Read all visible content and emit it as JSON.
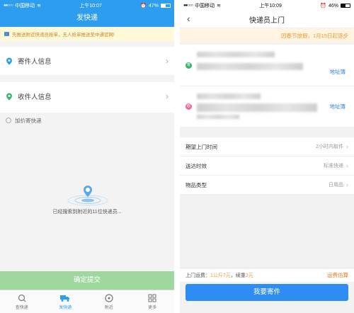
{
  "left": {
    "status": {
      "carrier": "中国移动",
      "time": "上午10:07",
      "battery": "47%",
      "battery_level": 0.47
    },
    "title": "发快递",
    "notice": "先推送附近快递员抢单，无人抢单推送至中通官网!",
    "sender_label": "寄件人信息",
    "receiver_label": "收件人信息",
    "insured_label": "加价寄快递",
    "searching_text": "已经搜索到附近的11位快递员...",
    "submit_label": "确定提交",
    "tabs": [
      {
        "label": "查快递",
        "icon": "search-icon"
      },
      {
        "label": "发快递",
        "icon": "truck-icon"
      },
      {
        "label": "附近",
        "icon": "nearby-icon"
      },
      {
        "label": "更多",
        "icon": "grid-icon"
      }
    ],
    "colors": {
      "primary": "#2d9df0",
      "submit_disabled": "#9ed89f"
    }
  },
  "right": {
    "status": {
      "carrier": "中国移动",
      "time": "上午10:09",
      "battery": "46%",
      "battery_level": 0.46
    },
    "title": "快递员上门",
    "holiday_notice": "因春节放假，1月15日起逐步",
    "sender_badge": "寄",
    "receiver_badge": "收",
    "address_book_label": "地址簿",
    "options": [
      {
        "label": "期望上门时间",
        "value": "2小时内取件"
      },
      {
        "label": "送达时效",
        "value": "标准快递"
      },
      {
        "label": "物品类型",
        "value": "日用品"
      }
    ],
    "fee": {
      "prefix": "上门运费：",
      "w1": "1公斤",
      "p1": "7元",
      "mid": "，续重",
      "p2": "2元"
    },
    "estimate_label": "运费估算",
    "order_label": "我要寄件",
    "colors": {
      "primary": "#2d8df2",
      "accent": "#f39a2e"
    }
  }
}
